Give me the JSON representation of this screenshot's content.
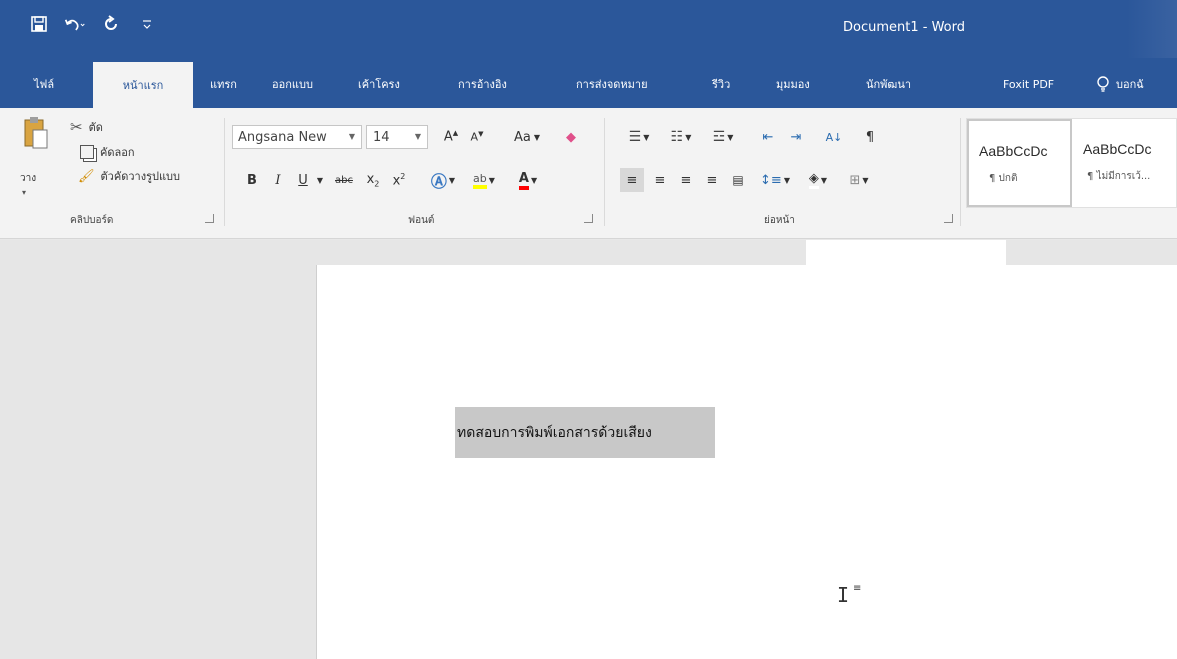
{
  "titlebar": {
    "doc_title": "Document1 - Word",
    "qat": {
      "save_icon": "save-icon",
      "undo_icon": "undo-icon",
      "redo_icon": "redo-icon",
      "customize_icon": "customize-qat-icon"
    }
  },
  "tabs": [
    {
      "label": "ไฟล์"
    },
    {
      "label": "หน้าแรก"
    },
    {
      "label": "แทรก"
    },
    {
      "label": "ออกแบบ"
    },
    {
      "label": "เค้าโครง"
    },
    {
      "label": "การอ้างอิง"
    },
    {
      "label": "การส่งจดหมาย"
    },
    {
      "label": "รีวิว"
    },
    {
      "label": "มุมมอง"
    },
    {
      "label": "นักพัฒนา"
    },
    {
      "label": "Foxit PDF"
    }
  ],
  "tell_me": {
    "label": "บอกฉั"
  },
  "clipboard": {
    "paste_label": "วาง",
    "cut_label": "ตัด",
    "copy_label": "คัดลอก",
    "format_painter_label": "ตัวคัดวางรูปแบบ",
    "group_label": "คลิปบอร์ด"
  },
  "font": {
    "name": "Angsana New",
    "size": "14",
    "change_case_label": "Aa",
    "group_label": "ฟอนต์"
  },
  "paragraph": {
    "group_label": "ย่อหน้า"
  },
  "styles": [
    {
      "sample": "AaBbCcDc",
      "name": "¶ ปกติ"
    },
    {
      "sample": "AaBbCcDc",
      "name": "¶ ไม่มีการเว้..."
    }
  ],
  "document": {
    "selected_text": "ทดสอบการพิมพ์เอกสารด้วยเสียง"
  },
  "colors": {
    "accent": "#2b579a",
    "highlight": "#ffff00",
    "font_color": "#ff0000"
  }
}
